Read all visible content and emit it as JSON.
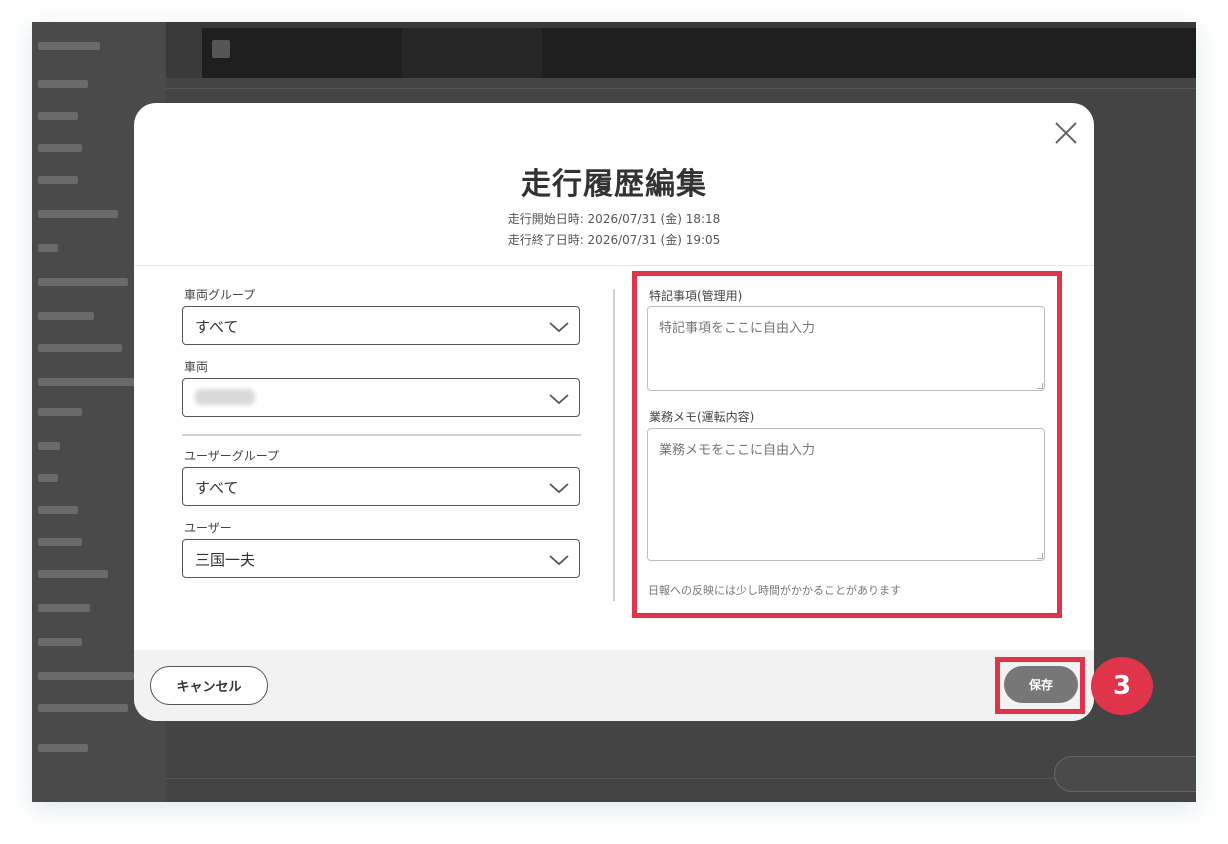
{
  "modal": {
    "title": "走行履歴編集",
    "start_time": "走行開始日時: 2026/07/31 (金) 18:18",
    "end_time": "走行終了日時: 2026/07/31 (金) 19:05"
  },
  "form": {
    "vehicle_group": {
      "label": "車両グループ",
      "value": "すべて"
    },
    "vehicle": {
      "label": "車両",
      "value": ""
    },
    "user_group": {
      "label": "ユーザーグループ",
      "value": "すべて"
    },
    "user": {
      "label": "ユーザー",
      "value": "三国一夫"
    },
    "special_notes": {
      "label": "特記事項(管理用)",
      "placeholder": "特記事項をここに自由入力"
    },
    "work_memo": {
      "label": "業務メモ(運転内容)",
      "placeholder": "業務メモをここに自由入力"
    },
    "hint": "日報への反映には少し時間がかかることがあります"
  },
  "footer": {
    "cancel_label": "キャンセル",
    "save_label": "保存"
  },
  "annotation": {
    "step_number": "3",
    "highlight_color": "#e0344b"
  },
  "icons": {
    "close": "close-icon",
    "dropdown": "chevron-down-icon"
  }
}
